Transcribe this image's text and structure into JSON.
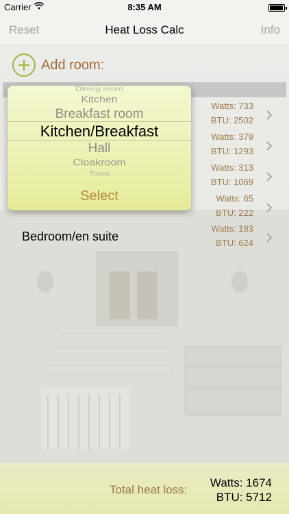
{
  "status_bar": {
    "carrier": "Carrier",
    "time": "8:35 AM"
  },
  "nav": {
    "reset_label": "Reset",
    "title": "Heat Loss Calc",
    "info_label": "Info"
  },
  "add_room": {
    "label": "Add room:",
    "icon": "plus-circle-icon"
  },
  "picker": {
    "items": [
      "Dining room",
      "Kitchen",
      "Breakfast room",
      "Kitchen/Breakfast",
      "Hall",
      "Cloakroom",
      "Toilet"
    ],
    "selected": "Kitchen/Breakfast",
    "select_label": "Select"
  },
  "rooms": [
    {
      "name": "",
      "watts": "Watts: 733",
      "btu": "BTU: 2502"
    },
    {
      "name": "",
      "watts": "Watts: 379",
      "btu": "BTU: 1293"
    },
    {
      "name": "",
      "watts": "Watts: 313",
      "btu": "BTU: 1069"
    },
    {
      "name": "",
      "watts": "Watts: 65",
      "btu": "BTU: 222"
    },
    {
      "name": "Bedroom/en suite",
      "watts": "Watts: 183",
      "btu": "BTU: 624"
    }
  ],
  "footer": {
    "total_label": "Total heat loss:",
    "watts": "Watts: 1674",
    "btu": "BTU: 5712"
  },
  "colors": {
    "accent_green": "#9fb33c",
    "label_brown": "#9b7a4e",
    "add_label": "#9d6a3a"
  }
}
